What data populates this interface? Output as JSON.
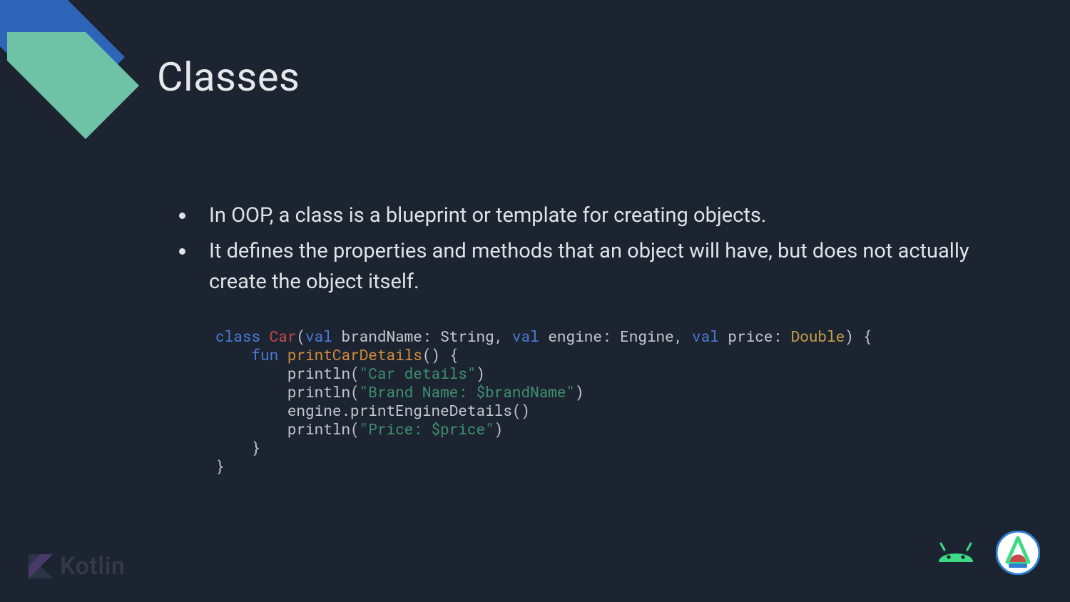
{
  "slide": {
    "title": "Classes",
    "bullets": [
      "In OOP, a class is a blueprint or template for creating objects.",
      "It defines the properties and methods that an object will have, but does not actually create the object itself."
    ],
    "code": {
      "kw_class": "class",
      "class_name": "Car",
      "paren_open": "(",
      "kw_val1": "val",
      "param1_name": " brandName: String, ",
      "kw_val2": "val",
      "param2_name": " engine: Engine, ",
      "kw_val3": "val",
      "param3_name": " price: ",
      "type_double": "Double",
      "paren_close_brace": ") {",
      "indent1": "    ",
      "kw_fun": "fun",
      "space1": " ",
      "fn_name": "printCarDetails",
      "fn_sig_tail": "() {",
      "indent2": "        ",
      "println1a": "println(",
      "str1": "\"Car details\"",
      "println1b": ")",
      "println2a": "println(",
      "str2": "\"Brand Name: $brandName\"",
      "println2b": ")",
      "line_engine": "engine.printEngineDetails()",
      "println4a": "println(",
      "str4": "\"Price: $price\"",
      "println4b": ")",
      "close_inner": "    }",
      "close_outer": "}"
    },
    "footer": {
      "kotlin_label": "Kotlin"
    }
  }
}
